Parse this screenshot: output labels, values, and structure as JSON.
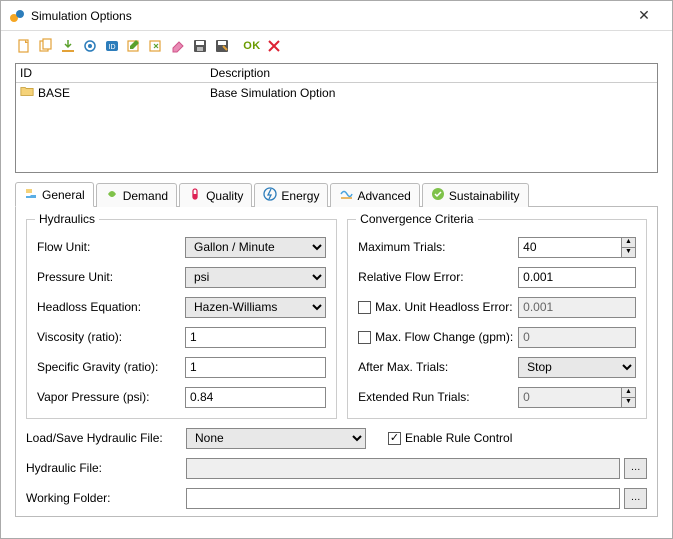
{
  "window": {
    "title": "Simulation Options"
  },
  "list": {
    "headers": {
      "id": "ID",
      "desc": "Description"
    },
    "rows": [
      {
        "id": "BASE",
        "desc": "Base Simulation Option"
      }
    ]
  },
  "tabs": [
    {
      "label": "General"
    },
    {
      "label": "Demand"
    },
    {
      "label": "Quality"
    },
    {
      "label": "Energy"
    },
    {
      "label": "Advanced"
    },
    {
      "label": "Sustainability"
    }
  ],
  "hydraulics": {
    "legend": "Hydraulics",
    "flow_unit_label": "Flow Unit:",
    "flow_unit_value": "Gallon / Minute",
    "pressure_unit_label": "Pressure Unit:",
    "pressure_unit_value": "psi",
    "headloss_label": "Headloss Equation:",
    "headloss_value": "Hazen-Williams",
    "viscosity_label": "Viscosity (ratio):",
    "viscosity_value": "1",
    "gravity_label": "Specific Gravity (ratio):",
    "gravity_value": "1",
    "vapor_label": "Vapor Pressure (psi):",
    "vapor_value": "0.84"
  },
  "convergence": {
    "legend": "Convergence Criteria",
    "max_trials_label": "Maximum Trials:",
    "max_trials_value": "40",
    "rel_flow_label": "Relative Flow Error:",
    "rel_flow_value": "0.001",
    "max_headloss_label": "Max. Unit Headloss Error:",
    "max_headloss_value": "0.001",
    "max_flowchange_label": "Max. Flow Change (gpm):",
    "max_flowchange_value": "0",
    "after_max_label": "After Max. Trials:",
    "after_max_value": "Stop",
    "ext_run_label": "Extended Run Trials:",
    "ext_run_value": "0"
  },
  "bottom": {
    "loadsave_label": "Load/Save Hydraulic File:",
    "loadsave_value": "None",
    "rule_control_label": "Enable Rule Control",
    "hydraulic_file_label": "Hydraulic File:",
    "hydraulic_file_value": "",
    "working_folder_label": "Working Folder:",
    "working_folder_value": ""
  }
}
